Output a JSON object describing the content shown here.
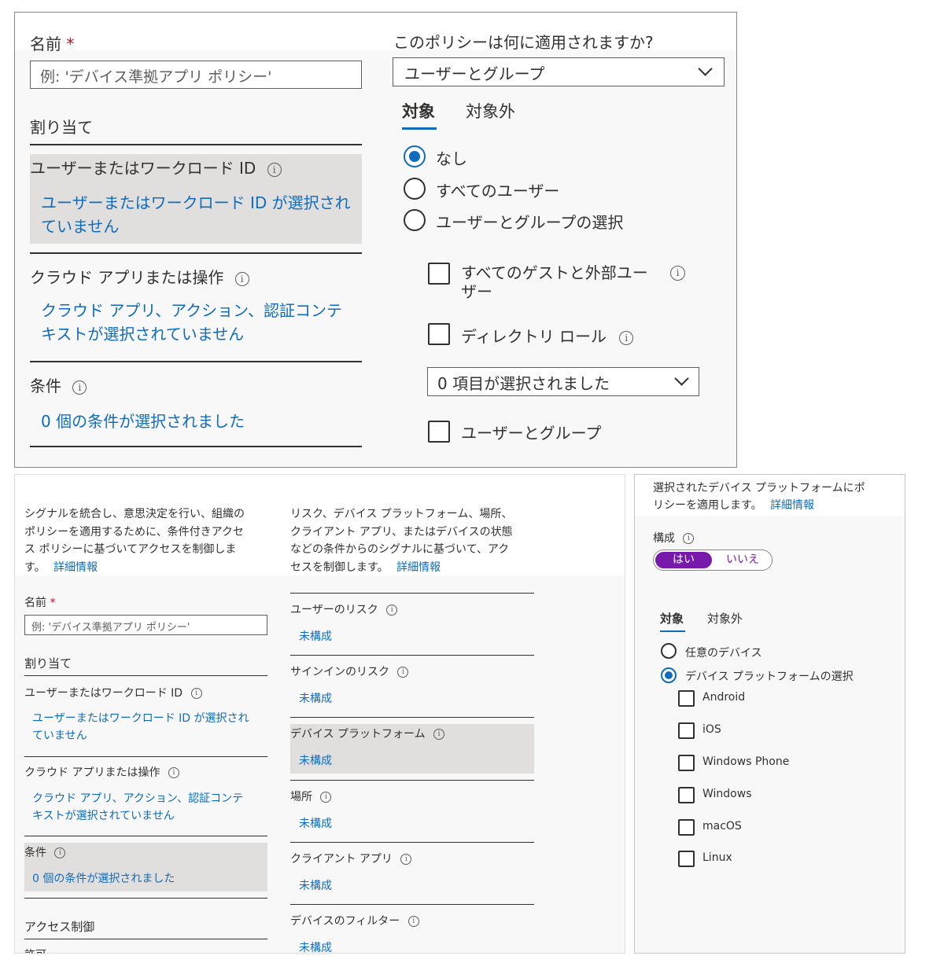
{
  "top": {
    "name_label": "名前",
    "required_mark": "*",
    "name_placeholder": "例: 'デバイス準拠アプリ ポリシー'",
    "assignments_label": "割り当て",
    "users_label": "ユーザーまたはワークロード ID",
    "users_value_line1": "ユーザーまたはワークロード ID が選択され",
    "users_value_line2": "ていません",
    "cloud_label": "クラウド アプリまたは操作",
    "cloud_value_line1": "クラウド アプリ、アクション、認証コンテ",
    "cloud_value_line2": "キストが選択されていません",
    "conditions_label": "条件",
    "conditions_value": "0 個の条件が選択されました",
    "applies_question": "このポリシーは何に適用されますか?",
    "applies_select": "ユーザーとグループ",
    "tab_include": "対象",
    "tab_exclude": "対象外",
    "radio_none": "なし",
    "radio_all_users": "すべてのユーザー",
    "radio_select": "ユーザーとグループの選択",
    "cb_guests_line1": "すべてのゲストと外部ユー",
    "cb_guests_line2": "ザー",
    "cb_directory_roles": "ディレクトリ ロール",
    "roles_select": "0 項目が選択されました",
    "cb_users_groups": "ユーザーとグループ"
  },
  "bottom_left": {
    "desc1_line1": "シグナルを統合し、意思決定を行い、組織の",
    "desc1_line2": "ポリシーを適用するために、条件付きアクセ",
    "desc1_line3": "ス ポリシーに基づいてアクセスを制御しま",
    "desc1_line4": "す。",
    "desc1_link": "詳細情報",
    "desc2_line1": "リスク、デバイス プラットフォーム、場所、",
    "desc2_line2": "クライアント アプリ、またはデバイスの状態",
    "desc2_line3": "などの条件からのシグナルに基づいて、アク",
    "desc2_line4": "セスを制御します。",
    "desc2_link": "詳細情報",
    "name_label": "名前",
    "required_mark": "*",
    "name_placeholder": "例: 'デバイス準拠アプリ ポリシー'",
    "assignments_label": "割り当て",
    "users_label": "ユーザーまたはワークロード ID",
    "users_value_line1": "ユーザーまたはワークロード ID が選択され",
    "users_value_line2": "ていません",
    "cloud_label": "クラウド アプリまたは操作",
    "cloud_value_line1": "クラウド アプリ、アクション、認証コンテ",
    "cloud_value_line2": "キストが選択されていません",
    "conditions_label": "条件",
    "conditions_value": "0 個の条件が選択されました",
    "access_control_label": "アクセス制御",
    "grant_label": "許可",
    "conditions_list": [
      {
        "label": "ユーザーのリスク",
        "value": "未構成"
      },
      {
        "label": "サインインのリスク",
        "value": "未構成"
      },
      {
        "label": "デバイス プラットフォーム",
        "value": "未構成"
      },
      {
        "label": "場所",
        "value": "未構成"
      },
      {
        "label": "クライアント アプリ",
        "value": "未構成"
      },
      {
        "label": "デバイスのフィルター",
        "value": "未構成"
      }
    ]
  },
  "platform_pane": {
    "desc_line1": "選択されたデバイス プラットフォームにポ",
    "desc_line2": "リシーを適用します。",
    "desc_link": "詳細情報",
    "configure_label": "構成",
    "toggle_yes": "はい",
    "toggle_no": "いいえ",
    "tab_include": "対象",
    "tab_exclude": "対象外",
    "radio_any": "任意のデバイス",
    "radio_select": "デバイス プラットフォームの選択",
    "platforms": [
      "Android",
      "iOS",
      "Windows Phone",
      "Windows",
      "macOS",
      "Linux"
    ]
  },
  "colors": {
    "link": "#0f6cbd",
    "required": "#c50f1f",
    "toggle_accent": "#7719aa",
    "selected_row": "#e1dfdd"
  }
}
